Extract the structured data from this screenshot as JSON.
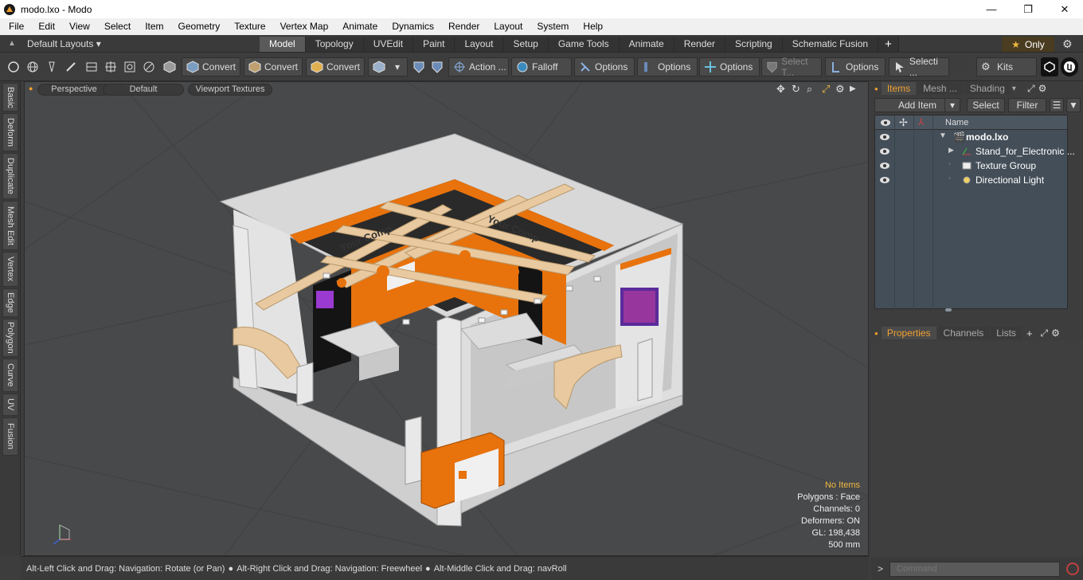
{
  "window": {
    "title": "modo.lxo - Modo",
    "icon": "modo-app-icon",
    "controls": [
      "—",
      "❐",
      "✕"
    ]
  },
  "menubar": [
    "File",
    "Edit",
    "View",
    "Select",
    "Item",
    "Geometry",
    "Texture",
    "Vertex Map",
    "Animate",
    "Dynamics",
    "Render",
    "Layout",
    "System",
    "Help"
  ],
  "layoutbar": {
    "layout_select": "Default Layouts",
    "tabs": [
      "Model",
      "Topology",
      "UVEdit",
      "Paint",
      "Layout",
      "Setup",
      "Game Tools",
      "Animate",
      "Render",
      "Scripting",
      "Schematic Fusion"
    ],
    "active_tab": "Model",
    "add_tab": "+",
    "only_label": "Only"
  },
  "toolbar": {
    "convert1": "Convert",
    "convert2": "Convert",
    "convert3": "Convert",
    "action": "Action ...",
    "falloff": "Falloff",
    "options1": "Options",
    "options2": "Options",
    "options3": "Options",
    "select_t": "Select T...",
    "options4": "Options",
    "selecti": "Selecti ...",
    "kits": "Kits"
  },
  "left_tabs": [
    "Basic",
    "Deform",
    "Duplicate",
    "Mesh Edit",
    "Vertex",
    "Edge",
    "Polygon",
    "Curve",
    "UV",
    "Fusion"
  ],
  "viewport": {
    "view": "Perspective",
    "shading": "Default",
    "textures": "Viewport Textures",
    "info": {
      "no_items": "No Items",
      "polygons": "Polygons : Face",
      "channels": "Channels: 0",
      "deformers": "Deformers: ON",
      "gl": "GL: 198,438",
      "scale": "500 mm"
    },
    "booth_signs": [
      "Your Comp",
      "Your Comp"
    ]
  },
  "statusbar": {
    "hint1": "Alt-Left Click and Drag: Navigation: Rotate (or Pan)",
    "hint2": "Alt-Right Click and Drag: Navigation: Freewheel",
    "hint3": "Alt-Middle Click and Drag: navRoll"
  },
  "items_panel": {
    "tabs": [
      "Items",
      "Mesh ...",
      "Shading"
    ],
    "active_tab": "Items",
    "add_item": "Add Item",
    "select": "Select",
    "filter": "Filter",
    "column_name": "Name",
    "rows": [
      {
        "label": "modo.lxo",
        "icon": "scene-icon",
        "indent": 0
      },
      {
        "label": "Stand_for_Electronic ...",
        "icon": "mesh-item-icon",
        "indent": 1
      },
      {
        "label": "Texture Group",
        "icon": "texture-group-icon",
        "indent": 1
      },
      {
        "label": "Directional Light",
        "icon": "light-icon",
        "indent": 1
      }
    ]
  },
  "properties_panel": {
    "tabs": [
      "Properties",
      "Channels",
      "Lists"
    ],
    "active_tab": "Properties",
    "add": "+"
  },
  "command": {
    "prompt": ">",
    "placeholder": "Command"
  },
  "colors": {
    "accent_orange": "#f0a030",
    "booth_orange": "#e8720c",
    "viewport_bg": "#48494b"
  }
}
